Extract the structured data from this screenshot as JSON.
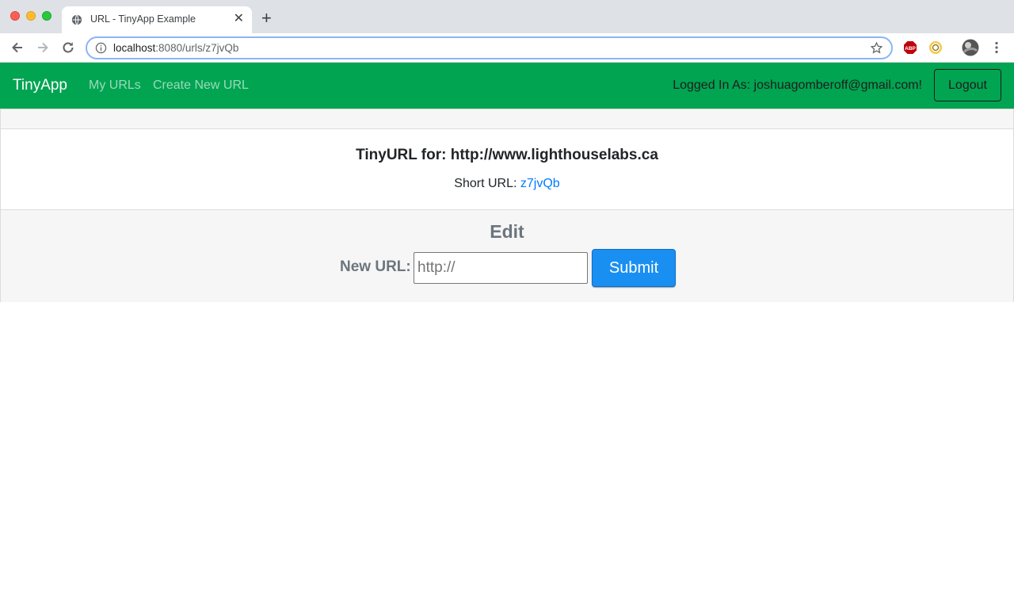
{
  "browser": {
    "tab_title": "URL - TinyApp Example",
    "url_host": "localhost",
    "url_rest": ":8080/urls/z7jvQb",
    "extensions": [
      "abp-icon",
      "extension-icon",
      "profile-avatar"
    ]
  },
  "nav": {
    "brand": "TinyApp",
    "links": [
      "My URLs",
      "Create New URL"
    ],
    "logged_in_text": "Logged In As: joshuagomberoff@gmail.com!",
    "logout_label": "Logout",
    "bg_color": "#00a451"
  },
  "card": {
    "title": "TinyURL for: http://www.lighthouselabs.ca",
    "short_url_label": "Short URL:",
    "short_url_value": "z7jvQb"
  },
  "edit": {
    "heading": "Edit",
    "new_url_label": "New URL:",
    "input_placeholder": "http://",
    "submit_label": "Submit",
    "submit_color": "#1a8ff2"
  }
}
